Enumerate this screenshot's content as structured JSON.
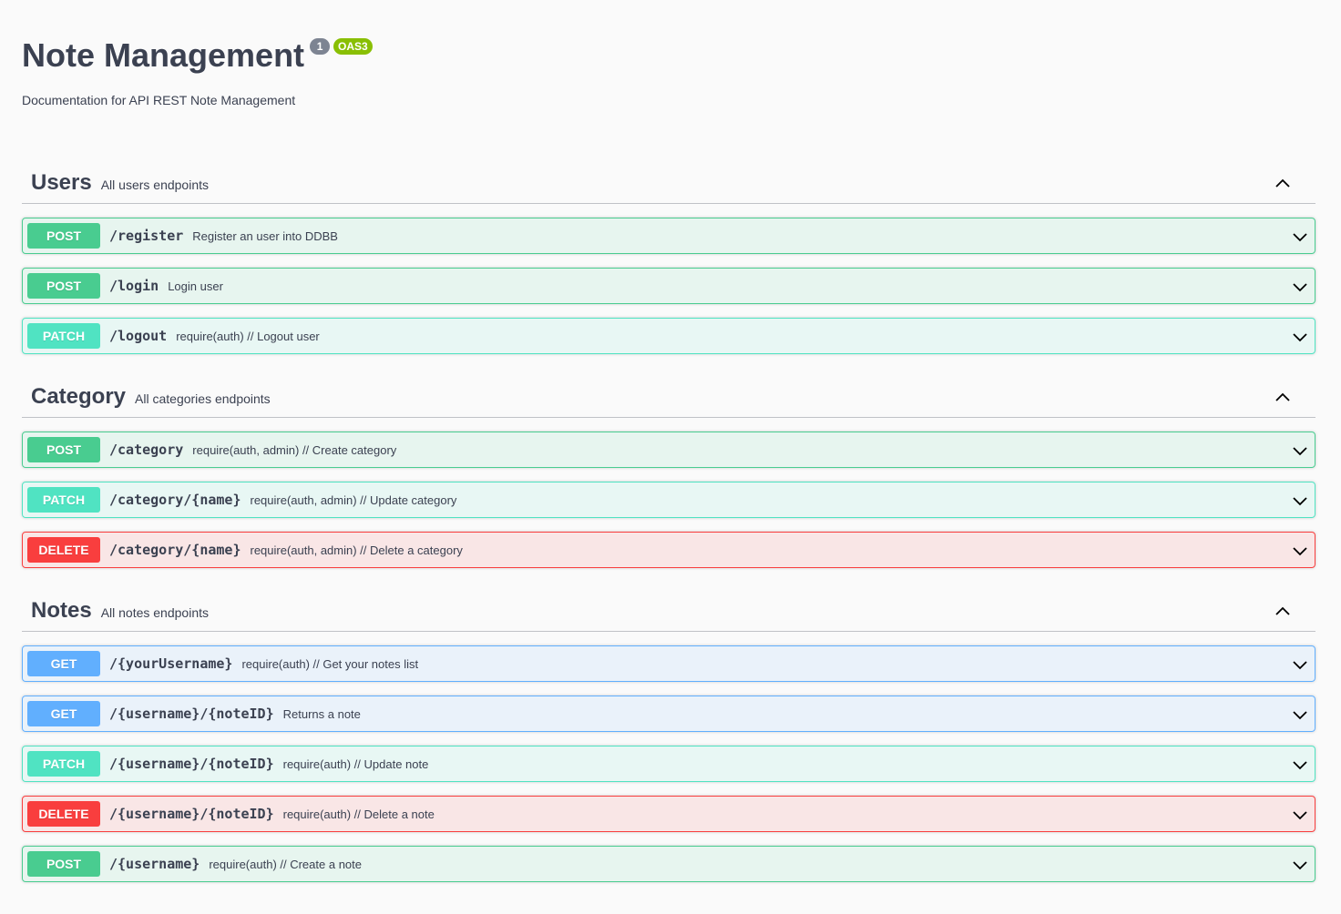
{
  "info": {
    "title": "Note Management",
    "version": "1",
    "oas_badge": "OAS3",
    "description": "Documentation for API REST Note Management"
  },
  "tags": [
    {
      "name": "Users",
      "description": "All users endpoints",
      "operations": [
        {
          "method": "POST",
          "path": "/register",
          "summary": "Register an user into DDBB"
        },
        {
          "method": "POST",
          "path": "/login",
          "summary": "Login user"
        },
        {
          "method": "PATCH",
          "path": "/logout",
          "summary": "require(auth) // Logout user"
        }
      ]
    },
    {
      "name": "Category",
      "description": "All categories endpoints",
      "operations": [
        {
          "method": "POST",
          "path": "/category",
          "summary": "require(auth, admin) // Create category"
        },
        {
          "method": "PATCH",
          "path": "/category/{name}",
          "summary": "require(auth, admin) // Update category"
        },
        {
          "method": "DELETE",
          "path": "/category/{name}",
          "summary": "require(auth, admin) // Delete a category"
        }
      ]
    },
    {
      "name": "Notes",
      "description": "All notes endpoints",
      "operations": [
        {
          "method": "GET",
          "path": "/{yourUsername}",
          "summary": "require(auth) // Get your notes list"
        },
        {
          "method": "GET",
          "path": "/{username}/{noteID}",
          "summary": "Returns a note"
        },
        {
          "method": "PATCH",
          "path": "/{username}/{noteID}",
          "summary": "require(auth) // Update note"
        },
        {
          "method": "DELETE",
          "path": "/{username}/{noteID}",
          "summary": "require(auth) // Delete a note"
        },
        {
          "method": "POST",
          "path": "/{username}",
          "summary": "require(auth) // Create a note"
        }
      ]
    }
  ],
  "colors": {
    "post": "#49cc90",
    "patch": "#50e3c2",
    "delete": "#f93e3e",
    "get": "#61affe",
    "version_badge": "#7d8492",
    "oas_badge": "#89bf04"
  },
  "icons": {
    "tag_toggle": "chevron-up-icon",
    "operation_toggle": "chevron-down-icon"
  }
}
